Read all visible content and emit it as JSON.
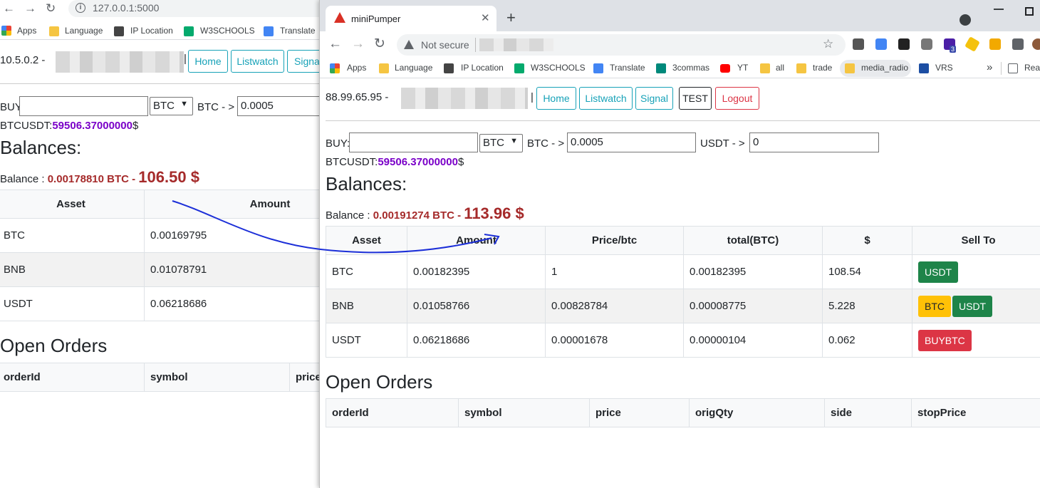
{
  "bg_window": {
    "url": "127.0.0.1:5000",
    "bookmarks": [
      "Apps",
      "Language",
      "IP Location",
      "W3SCHOOLS",
      "Translate"
    ],
    "ip": "10.5.0.2 -",
    "nav_buttons": [
      "Home",
      "Listwatch",
      "Signa"
    ],
    "buy_label": "BUY:",
    "currency": "BTC",
    "btc_arrow": "BTC - >",
    "btc_amount": "0.0005",
    "price_label": "BTCUSDT:",
    "price_value": "59506.37000000",
    "price_suffix": "$",
    "balances_heading": "Balances:",
    "balance_label": "Balance :",
    "balance_btc": "0.00178810 BTC -",
    "balance_usd": "106.50 $",
    "table_headers": [
      "Asset",
      "Amount"
    ],
    "rows": [
      {
        "asset": "BTC",
        "amount": "0.00169795"
      },
      {
        "asset": "BNB",
        "amount": "0.01078791"
      },
      {
        "asset": "USDT",
        "amount": "0.06218686"
      }
    ],
    "open_orders_heading": "Open Orders",
    "order_headers": [
      "orderId",
      "symbol",
      "price"
    ]
  },
  "fg_window": {
    "tab_title": "miniPumper",
    "security_label": "Not secure",
    "bookmarks": [
      "Apps",
      "Language",
      "IP Location",
      "W3SCHOOLS",
      "Translate",
      "3commas",
      "YT",
      "all",
      "trade",
      "media_radio",
      "VRS"
    ],
    "overflow": "»",
    "reading_list": "Read",
    "ip": "88.99.65.95 -",
    "nav_buttons": [
      "Home",
      "Listwatch",
      "Signal",
      "TEST",
      "Logout"
    ],
    "buy_label": "BUY:",
    "currency": "BTC",
    "btc_arrow": "BTC - >",
    "btc_amount": "0.0005",
    "usdt_arrow": "USDT - >",
    "usdt_amount": "0",
    "price_label": "BTCUSDT:",
    "price_value": "59506.37000000",
    "price_suffix": "$",
    "balances_heading": "Balances:",
    "balance_label": "Balance :",
    "balance_btc": "0.00191274 BTC -",
    "balance_usd": "113.96 $",
    "table_headers": [
      "Asset",
      "Amount",
      "Price/btc",
      "total(BTC)",
      "$",
      "Sell To"
    ],
    "rows": [
      {
        "asset": "BTC",
        "amount": "0.00182395",
        "price": "1",
        "total": "0.00182395",
        "usd": "108.54",
        "actions": [
          "USDT"
        ]
      },
      {
        "asset": "BNB",
        "amount": "0.01058766",
        "price": "0.00828784",
        "total": "0.00008775",
        "usd": "5.228",
        "actions": [
          "BTC",
          "USDT"
        ]
      },
      {
        "asset": "USDT",
        "amount": "0.06218686",
        "price": "0.00001678",
        "total": "0.00000104",
        "usd": "0.062",
        "actions": [
          "BUYBTC"
        ]
      }
    ],
    "open_orders_heading": "Open Orders",
    "order_headers": [
      "orderId",
      "symbol",
      "price",
      "origQty",
      "side",
      "stopPrice"
    ],
    "ext_badge": "3"
  },
  "colors": {
    "accent_teal": "#17a2b8",
    "danger": "#dc3545",
    "success": "#1e8449",
    "warning": "#ffc107",
    "price_purple": "#7a00c8",
    "balance_brown": "#a52a2a",
    "annotation_blue": "#1c2fd8"
  }
}
